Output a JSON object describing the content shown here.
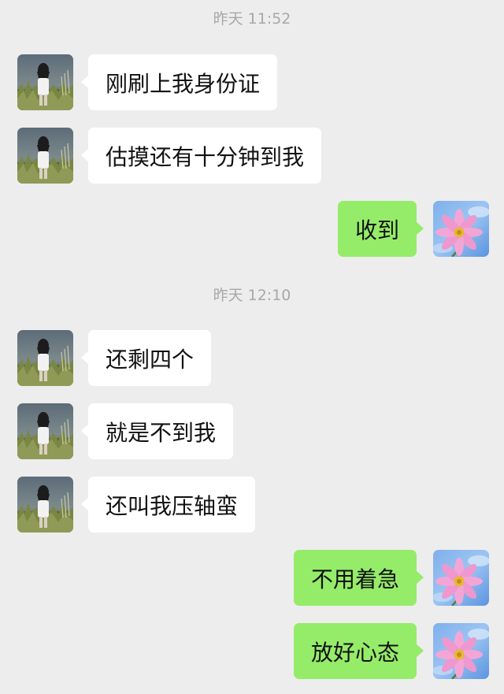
{
  "chat": {
    "timestamps": [
      "昨天 11:52",
      "昨天 12:10"
    ],
    "messages": [
      {
        "side": "left",
        "text": "刚刷上我身份证"
      },
      {
        "side": "left",
        "text": "估摸还有十分钟到我"
      },
      {
        "side": "right",
        "text": "收到"
      },
      {
        "side": "left",
        "text": "还剩四个"
      },
      {
        "side": "left",
        "text": "就是不到我"
      },
      {
        "side": "left",
        "text": "还叫我压轴蛮"
      },
      {
        "side": "right",
        "text": "不用着急"
      },
      {
        "side": "right",
        "text": "放好心态"
      }
    ]
  },
  "colors": {
    "background": "#ededed",
    "bubble_received": "#ffffff",
    "bubble_sent": "#95ec69",
    "timestamp_text": "#a8a8a8"
  },
  "icons": {
    "contact_avatar": "person-in-field-photo",
    "self_avatar": "pink-flower-sky-photo"
  }
}
